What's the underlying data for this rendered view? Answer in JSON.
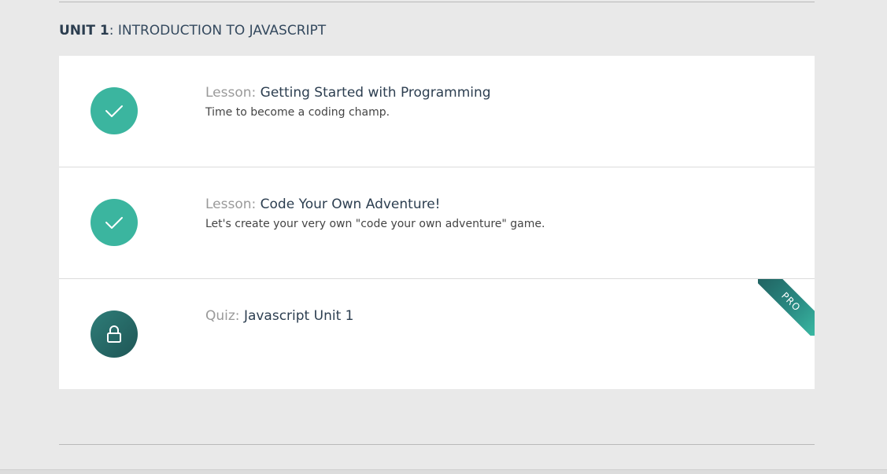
{
  "unit": {
    "number_label": "UNIT 1",
    "name_label": ": INTRODUCTION TO JAVASCRIPT"
  },
  "items": [
    {
      "type_label": "Lesson:",
      "title": "Getting Started with Programming",
      "description": "Time to become a coding champ.",
      "status": "completed",
      "status_icon": "checkmark-icon"
    },
    {
      "type_label": "Lesson:",
      "title": "Code Your Own Adventure!",
      "description": "Let's create your very own \"code your own adventure\" game.",
      "status": "completed",
      "status_icon": "checkmark-icon"
    },
    {
      "type_label": "Quiz:",
      "title": "Javascript Unit 1",
      "description": "",
      "status": "locked",
      "status_icon": "lock-icon",
      "badge": "PRO"
    }
  ],
  "colors": {
    "completed": "#3bb59f",
    "locked": "#2e7d78",
    "background": "#e9e9e9",
    "text": "#2c3e50"
  }
}
